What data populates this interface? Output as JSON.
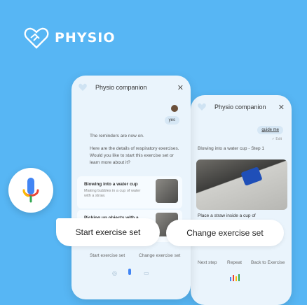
{
  "brand": {
    "name": "PHYSIO"
  },
  "left_phone": {
    "header_title": "Physio companion",
    "user_reply": "yes",
    "assistant_msg_1": "The reminders are now on.",
    "assistant_msg_2": "Here are the details of respiratory exercises. Would you like to start this exercise set or learn more about it?",
    "cards": [
      {
        "title": "Blowing into a water cup",
        "desc": "Making bubbles in a cup of water with a straw."
      },
      {
        "title": "Picking up objects with a",
        "desc": ""
      }
    ],
    "actions": [
      "Start exercise set",
      "Change exercise set"
    ]
  },
  "right_phone": {
    "header_title": "Physio companion",
    "user_reply": "guide me",
    "status": "✓ Edit",
    "step_title": "Blowing into a water cup - Step 1",
    "instruction": "Place a straw inside a cup of",
    "actions": [
      "Next step",
      "Repeat",
      "Back to Exercise"
    ]
  },
  "chips": [
    "Start exercise set",
    "Change exercise set"
  ]
}
